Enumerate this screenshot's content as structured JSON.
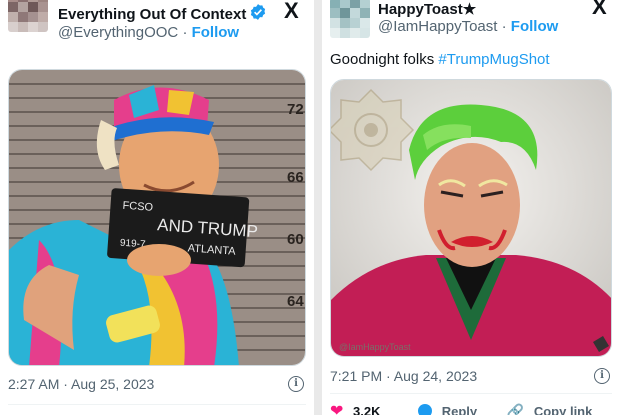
{
  "left_tweet": {
    "author_name": "Everything Out Of Context",
    "handle": "@EverythingOOC",
    "separator": "·",
    "follow_label": "Follow",
    "platform_logo": "X",
    "image": {
      "height_marks": [
        "72",
        "66",
        "60",
        "64"
      ],
      "placard_line1": "FCSO",
      "placard_line2": "AND TRUMP",
      "placard_line3_left": "919-7",
      "placard_line3_right": "ATLANTA"
    },
    "timestamp": "2:27 AM · Aug 25, 2023",
    "info_icon": "info-icon",
    "colors": {
      "visor": "#e53e8c",
      "shirt": "#2ab3d6"
    }
  },
  "right_tweet": {
    "author_name": "HappyToast★",
    "handle": "@IamHappyToast",
    "separator": "·",
    "follow_label": "Follow",
    "platform_logo": "X",
    "text_plain": "Goodnight folks ",
    "hashtag": "#TrumpMugShot",
    "image": {
      "watermark": "@IamHappyToast"
    },
    "timestamp": "7:21 PM · Aug 24, 2023",
    "info_icon": "info-icon",
    "actions": {
      "like_count": "3.2K",
      "reply_label": "Reply",
      "copy_link_label": "Copy link"
    },
    "colors": {
      "hair": "#5ccf3c",
      "suit": "#c21e55"
    }
  },
  "theme": {
    "link_blue": "#1d9bf0",
    "muted": "#536471",
    "like_pink": "#f91880"
  }
}
